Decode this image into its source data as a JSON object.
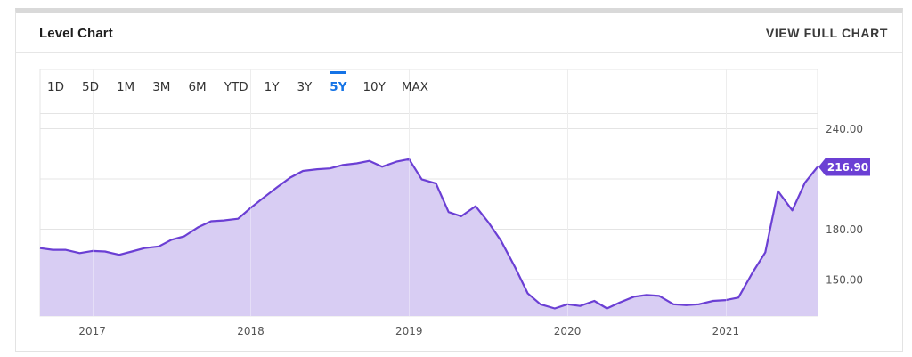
{
  "header": {
    "title": "Level Chart",
    "view_full_label": "VIEW FULL CHART"
  },
  "range_buttons": [
    "1D",
    "5D",
    "1M",
    "3M",
    "6M",
    "YTD",
    "1Y",
    "3Y",
    "5Y",
    "10Y",
    "MAX"
  ],
  "active_range": "5Y",
  "colors": {
    "line": "#6b3fd4",
    "fill": "#d8cdf3",
    "active": "#1473e6",
    "grid": "#e4e4e4"
  },
  "chart_data": {
    "type": "area",
    "title": "",
    "xlabel": "",
    "ylabel": "",
    "ylim": [
      128,
      275
    ],
    "y_ticks": [
      150,
      180,
      240
    ],
    "y_tick_labels": [
      "150.00",
      "180.00",
      "240.00"
    ],
    "x_tick_labels": [
      "2017",
      "2018",
      "2019",
      "2020",
      "2021"
    ],
    "x_ticks": [
      2017.0,
      2018.0,
      2019.0,
      2020.0,
      2021.0
    ],
    "xlim": [
      2016.67,
      2021.58
    ],
    "last_value": 216.9,
    "last_value_label": "216.90",
    "series": [
      {
        "values": [
          [
            2016.67,
            168.5
          ],
          [
            2016.75,
            167.5
          ],
          [
            2016.83,
            167.5
          ],
          [
            2016.92,
            165.5
          ],
          [
            2017.0,
            166.8
          ],
          [
            2017.08,
            166.5
          ],
          [
            2017.17,
            164.5
          ],
          [
            2017.25,
            166.5
          ],
          [
            2017.33,
            168.5
          ],
          [
            2017.42,
            169.5
          ],
          [
            2017.5,
            173.5
          ],
          [
            2017.58,
            175.5
          ],
          [
            2017.67,
            181.0
          ],
          [
            2017.75,
            184.5
          ],
          [
            2017.83,
            185.0
          ],
          [
            2017.92,
            186.0
          ],
          [
            2018.0,
            192.5
          ],
          [
            2018.08,
            198.5
          ],
          [
            2018.17,
            205.0
          ],
          [
            2018.25,
            210.5
          ],
          [
            2018.33,
            214.5
          ],
          [
            2018.42,
            215.5
          ],
          [
            2018.5,
            216.0
          ],
          [
            2018.58,
            218.0
          ],
          [
            2018.67,
            219.0
          ],
          [
            2018.75,
            220.5
          ],
          [
            2018.83,
            217.0
          ],
          [
            2018.92,
            220.0
          ],
          [
            2019.0,
            221.5
          ],
          [
            2019.08,
            209.5
          ],
          [
            2019.17,
            207.0
          ],
          [
            2019.25,
            190.0
          ],
          [
            2019.33,
            187.5
          ],
          [
            2019.42,
            193.5
          ],
          [
            2019.5,
            184.0
          ],
          [
            2019.58,
            173.0
          ],
          [
            2019.67,
            157.0
          ],
          [
            2019.75,
            141.5
          ],
          [
            2019.83,
            135.0
          ],
          [
            2019.92,
            132.5
          ],
          [
            2020.0,
            135.0
          ],
          [
            2020.08,
            134.0
          ],
          [
            2020.17,
            137.0
          ],
          [
            2020.25,
            132.5
          ],
          [
            2020.33,
            136.0
          ],
          [
            2020.42,
            139.5
          ],
          [
            2020.5,
            140.5
          ],
          [
            2020.58,
            140.0
          ],
          [
            2020.67,
            135.0
          ],
          [
            2020.75,
            134.5
          ],
          [
            2020.83,
            135.0
          ],
          [
            2020.92,
            137.0
          ],
          [
            2021.0,
            137.5
          ],
          [
            2021.08,
            139.0
          ],
          [
            2021.17,
            154.0
          ],
          [
            2021.25,
            166.0
          ],
          [
            2021.33,
            202.5
          ],
          [
            2021.42,
            191.0
          ],
          [
            2021.5,
            207.5
          ],
          [
            2021.58,
            216.9
          ]
        ]
      }
    ]
  }
}
